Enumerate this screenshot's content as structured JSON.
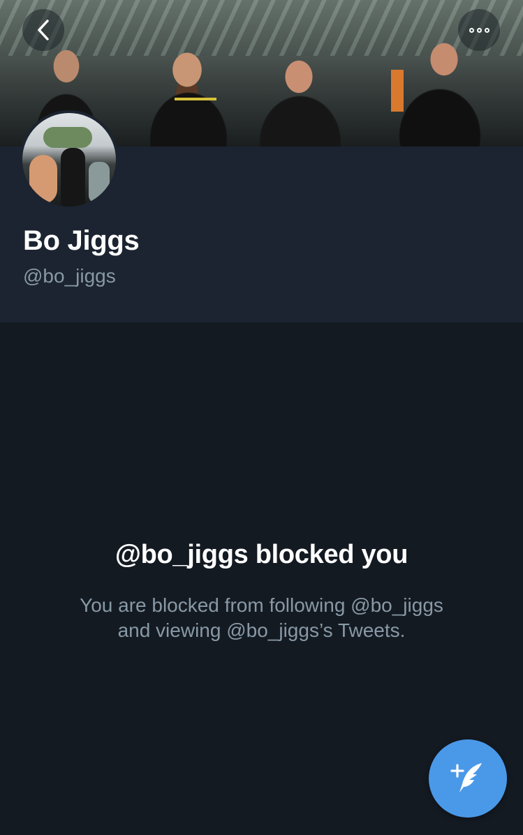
{
  "profile": {
    "display_name": "Bo Jiggs",
    "handle": "@bo_jiggs"
  },
  "icons": {
    "back": "chevron-left-icon",
    "more": "more-horizontal-icon",
    "compose": "compose-tweet-icon"
  },
  "blocked": {
    "title": "@bo_jiggs blocked you",
    "line1": "You are blocked from following @bo_jiggs",
    "line2": "and viewing @bo_jiggs’s Tweets."
  },
  "colors": {
    "background": "#141a22",
    "header_background": "#1b2430",
    "accent": "#4a99e9",
    "secondary_text": "#8899a6"
  }
}
